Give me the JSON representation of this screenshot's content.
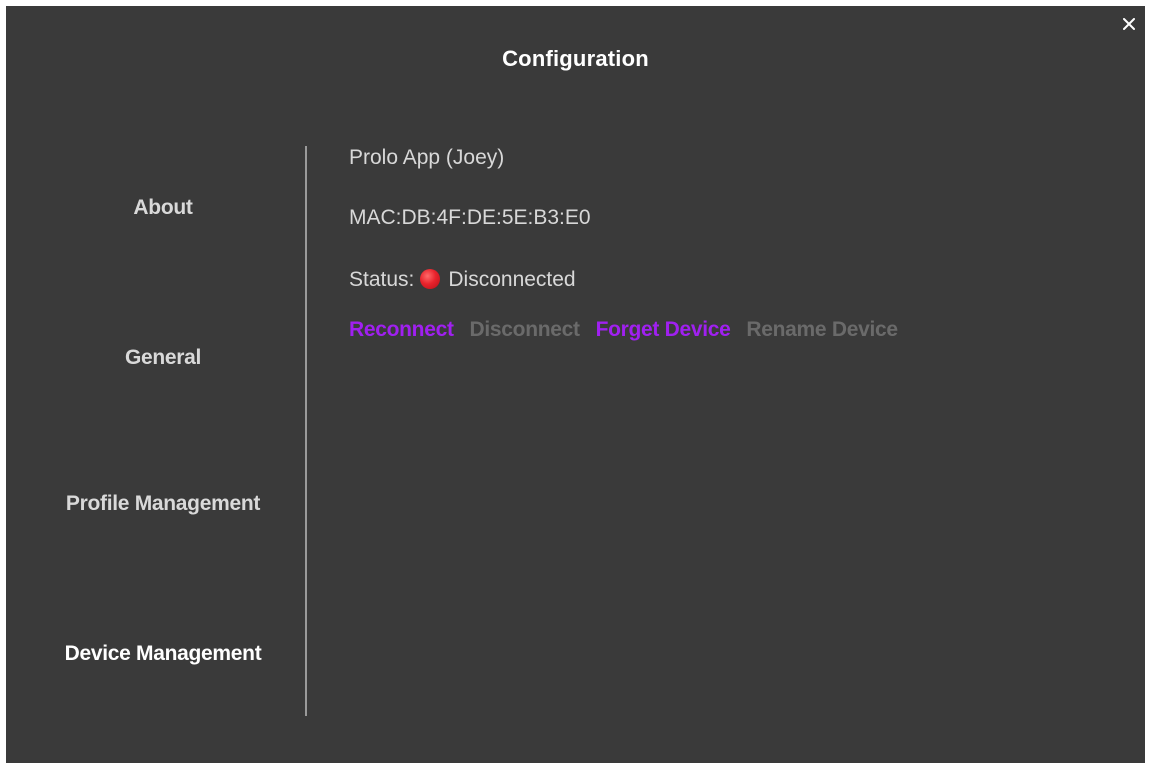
{
  "dialog": {
    "title": "Configuration",
    "close_icon": "close-icon"
  },
  "sidebar": {
    "items": [
      {
        "label": "About",
        "active": false
      },
      {
        "label": "General",
        "active": false
      },
      {
        "label": "Profile Management",
        "active": false
      },
      {
        "label": "Device Management",
        "active": true
      }
    ]
  },
  "device": {
    "name_line": "Prolo App  (Joey)",
    "mac_line": "MAC:DB:4F:DE:5E:B3:E0",
    "status_label": "Status:",
    "status_icon": "red-dot-icon",
    "status_value": "Disconnected",
    "status_color": "#e8232c"
  },
  "actions": {
    "reconnect": "Reconnect",
    "disconnect": "Disconnect",
    "forget": "Forget Device",
    "rename": "Rename Device",
    "enabled_color": "#a020f0",
    "disabled_color": "#6a6a6a"
  },
  "theme": {
    "background": "#3a3a3a",
    "divider": "#9a9a9a"
  }
}
